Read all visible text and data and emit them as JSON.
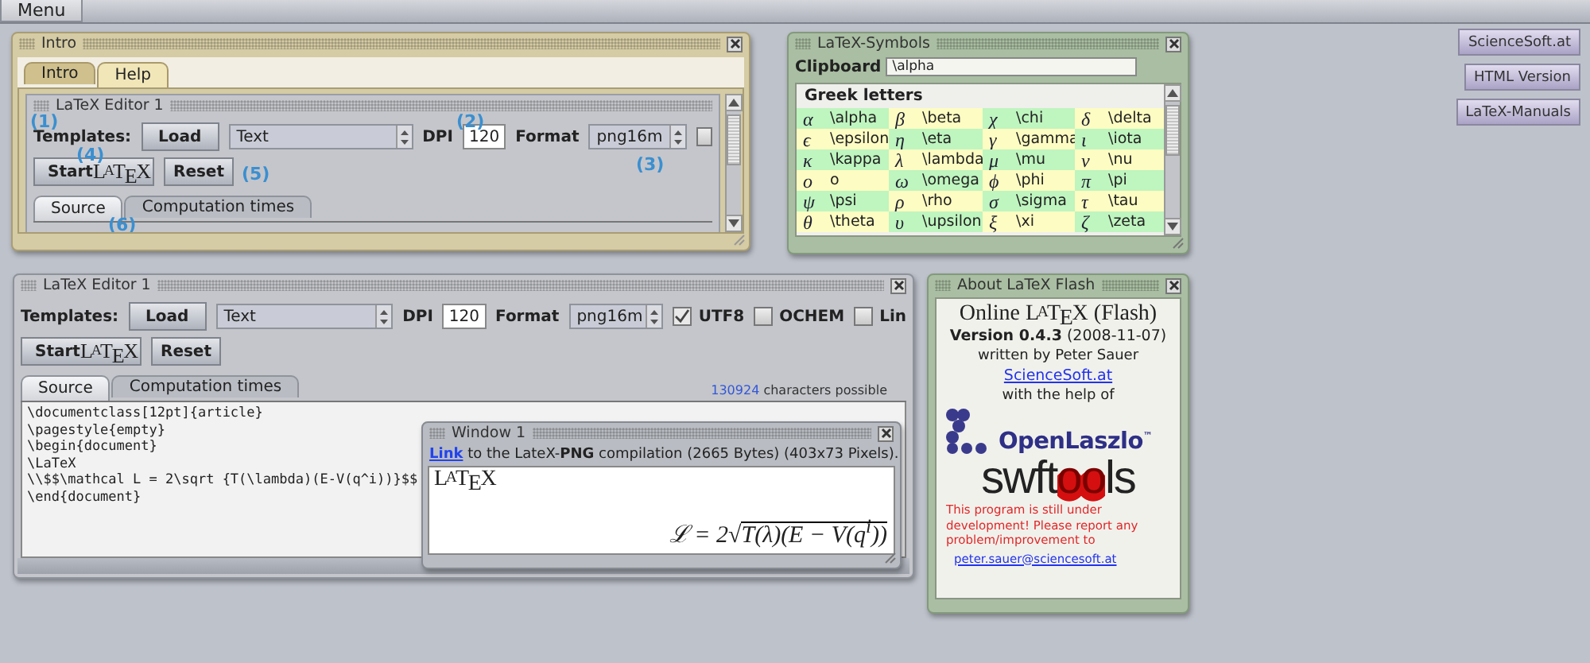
{
  "menu_bar": {
    "menu": "Menu"
  },
  "intro_window": {
    "title": "Intro",
    "tabs": [
      {
        "label": "Intro",
        "selected": false
      },
      {
        "label": "Help",
        "selected": true
      }
    ],
    "editor": {
      "title": "LaTeX Editor 1",
      "templates_label": "Templates:",
      "load_button": "Load",
      "template_select": "Text",
      "dpi_label": "DPI",
      "dpi_value": "120",
      "format_label": "Format",
      "format_select": "png16m",
      "checkbox": {
        "checked": false
      },
      "start_button": {
        "label": "Start",
        "logo": "LATEX"
      },
      "reset_button": "Reset",
      "tabs": [
        {
          "label": "Source",
          "selected": true
        },
        {
          "label": "Computation times",
          "selected": false
        }
      ],
      "callouts": [
        "(1)",
        "(2)",
        "(3)",
        "(4)",
        "(5)",
        "(6)"
      ]
    }
  },
  "symbols_window": {
    "title": "LaTeX-Symbols",
    "clipboard_label": "Clipboard",
    "clipboard_value": "\\alpha",
    "group": "Greek letters",
    "symbols": [
      {
        "glyph": "α",
        "command": "\\alpha"
      },
      {
        "glyph": "β",
        "command": "\\beta"
      },
      {
        "glyph": "χ",
        "command": "\\chi"
      },
      {
        "glyph": "δ",
        "command": "\\delta"
      },
      {
        "glyph": "ϵ",
        "command": "\\epsilon"
      },
      {
        "glyph": "η",
        "command": "\\eta"
      },
      {
        "glyph": "γ",
        "command": "\\gamma"
      },
      {
        "glyph": "ι",
        "command": "\\iota"
      },
      {
        "glyph": "κ",
        "command": "\\kappa"
      },
      {
        "glyph": "λ",
        "command": "\\lambda"
      },
      {
        "glyph": "μ",
        "command": "\\mu"
      },
      {
        "glyph": "ν",
        "command": "\\nu"
      },
      {
        "glyph": "o",
        "command": "o"
      },
      {
        "glyph": "ω",
        "command": "\\omega"
      },
      {
        "glyph": "ϕ",
        "command": "\\phi"
      },
      {
        "glyph": "π",
        "command": "\\pi"
      },
      {
        "glyph": "ψ",
        "command": "\\psi"
      },
      {
        "glyph": "ρ",
        "command": "\\rho"
      },
      {
        "glyph": "σ",
        "command": "\\sigma"
      },
      {
        "glyph": "τ",
        "command": "\\tau"
      },
      {
        "glyph": "θ",
        "command": "\\theta"
      },
      {
        "glyph": "υ",
        "command": "\\upsilon"
      },
      {
        "glyph": "ξ",
        "command": "\\xi"
      },
      {
        "glyph": "ζ",
        "command": "\\zeta"
      }
    ]
  },
  "link_buttons": [
    "ScienceSoft.at",
    "HTML Version",
    "LaTeX-Manuals"
  ],
  "editor_window": {
    "title": "LaTeX Editor 1",
    "templates_label": "Templates:",
    "load_button": "Load",
    "template_select": "Text",
    "dpi_label": "DPI",
    "dpi_value": "120",
    "format_label": "Format",
    "format_select": "png16m",
    "checkboxes": [
      {
        "label": "UTF8",
        "checked": true
      },
      {
        "label": "OCHEM",
        "checked": false
      },
      {
        "label": "Lin",
        "checked": false
      }
    ],
    "start_button": {
      "label": "Start",
      "logo": "LATEX"
    },
    "reset_button": "Reset",
    "tabs": [
      {
        "label": "Source",
        "selected": true
      },
      {
        "label": "Computation times",
        "selected": false
      }
    ],
    "counter": {
      "count": "130924",
      "text": "characters possible"
    },
    "source_lines": [
      "\\documentclass[12pt]{article}",
      "\\pagestyle{empty}",
      "\\begin{document}",
      "\\LaTeX",
      "\\\\$$\\mathcal L = 2\\sqrt {T(\\lambda)(E-V(q^i))}$$",
      "\\end{document}"
    ]
  },
  "result_window": {
    "title": "Window 1",
    "link": "Link",
    "info": "to the LateX-**PNG** compilation (2665 Bytes) (403x73 Pixels).",
    "logo": "LATEX",
    "formula": {
      "lhs": "ℒ = 2√",
      "radicand": "T(λ)(E − V(q$^{i}$))"
    }
  },
  "about_window": {
    "title": "About LaTeX Flash",
    "heading": {
      "text": "Online",
      "logo": "LATEX",
      "suffix": "(Flash)"
    },
    "version": "**Version 0.4.3** (2008-11-07)",
    "author": "written by Peter Sauer",
    "site_link": "ScienceSoft.at",
    "help_text": "with the help of",
    "openlaszlo": {
      "name": "OpenLaszlo",
      "mark": "™"
    },
    "swftools": "swftools",
    "notice": "This program is still under development! Please report any problem/improvement to",
    "email": "peter.sauer@sciencesoft.at"
  }
}
